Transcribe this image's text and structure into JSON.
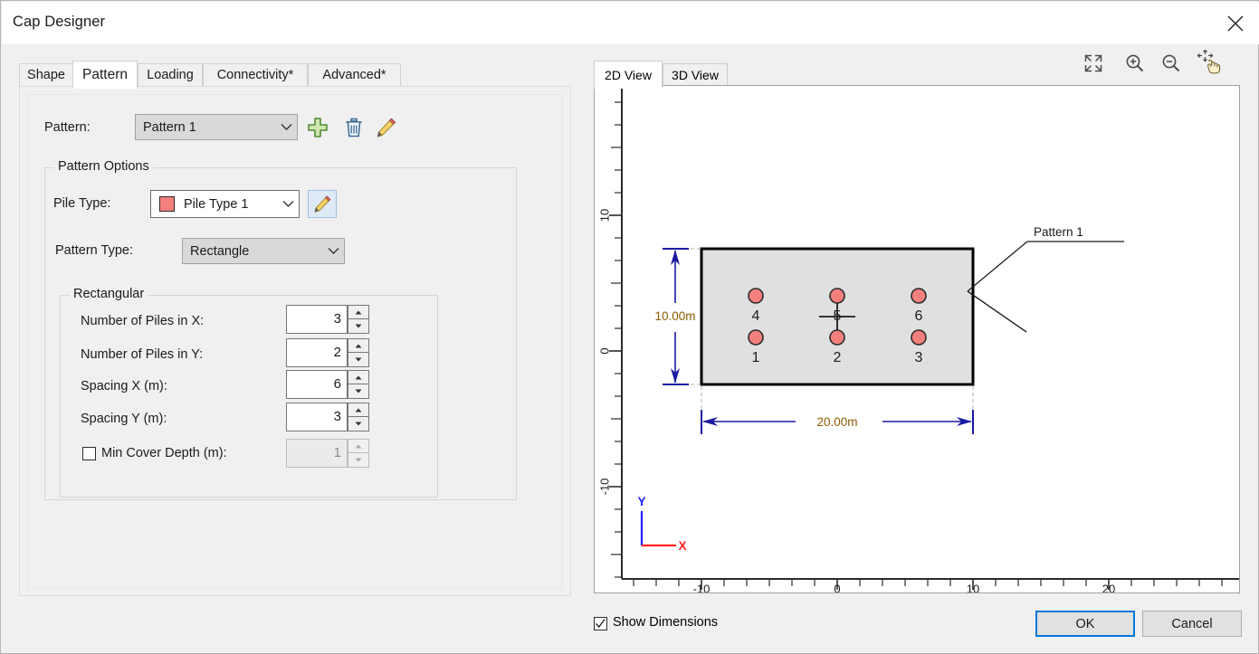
{
  "window": {
    "title": "Cap Designer",
    "close_icon": "close-icon"
  },
  "tabs": [
    {
      "label": "Shape",
      "active": false
    },
    {
      "label": "Pattern",
      "active": true
    },
    {
      "label": "Loading",
      "active": false
    },
    {
      "label": "Connectivity*",
      "active": false
    },
    {
      "label": "Advanced*",
      "active": false
    }
  ],
  "pattern_row": {
    "label": "Pattern:",
    "selected": "Pattern 1",
    "add_icon": "plus-icon",
    "delete_icon": "trash-icon",
    "edit_icon": "pencil-icon"
  },
  "pattern_options": {
    "title": "Pattern Options",
    "pile_type_label": "Pile Type:",
    "pile_type_value": "Pile Type 1",
    "pile_type_color": "#f4807e",
    "pile_type_edit_icon": "pencil-icon",
    "pattern_type_label": "Pattern Type:",
    "pattern_type_value": "Rectangle"
  },
  "rectangular": {
    "title": "Rectangular",
    "fields": [
      {
        "label": "Number of Piles in X:",
        "value": "3",
        "enabled": true
      },
      {
        "label": "Number of Piles in Y:",
        "value": "2",
        "enabled": true
      },
      {
        "label": "Spacing X (m):",
        "value": "6",
        "enabled": true
      },
      {
        "label": "Spacing Y (m):",
        "value": "3",
        "enabled": true
      }
    ],
    "min_cover": {
      "label": "Min Cover Depth (m):",
      "value": "1",
      "checked": false,
      "enabled": false
    }
  },
  "view": {
    "tabs": [
      {
        "label": "2D View",
        "active": true
      },
      {
        "label": "3D View",
        "active": false
      }
    ],
    "tools": [
      {
        "name": "fit-to-view-icon"
      },
      {
        "name": "zoom-in-icon"
      },
      {
        "name": "zoom-out-icon"
      },
      {
        "name": "pan-hand-icon"
      }
    ]
  },
  "footer": {
    "show_dimensions_label": "Show Dimensions",
    "show_dimensions_checked": true,
    "ok_label": "OK",
    "cancel_label": "Cancel"
  },
  "chart_data": {
    "type": "scatter",
    "title": "",
    "xlabel": "X",
    "ylabel": "Y",
    "xlim": [
      -16.5,
      26.5
    ],
    "ylim": [
      -15.5,
      15.5
    ],
    "x_ticks": [
      -10,
      0,
      10,
      20
    ],
    "x_tick_labels": [
      "-10",
      "0",
      "10",
      "20"
    ],
    "y_ticks": [
      10,
      0,
      -10
    ],
    "y_tick_labels": [
      "10",
      "0",
      "-10"
    ],
    "grid": false,
    "legend": "none",
    "cap_rectangle": {
      "x_min": -10,
      "x_max": 10,
      "y_min": -5,
      "y_max": 5,
      "fill": "#e0e0e0",
      "stroke": "#000000",
      "width_label": "20.00m",
      "height_label": "10.00m"
    },
    "dimension_color": "#1a1aa0",
    "pile_marker_color": "#f4807e",
    "pile_marker_edge": "#2b2b2b",
    "piles": [
      {
        "id": "1",
        "x": -6,
        "y": -1.5
      },
      {
        "id": "2",
        "x": 0,
        "y": -1.5
      },
      {
        "id": "3",
        "x": 6,
        "y": -1.5
      },
      {
        "id": "4",
        "x": -6,
        "y": 1.5
      },
      {
        "id": "5",
        "x": 0,
        "y": 1.5
      },
      {
        "id": "6",
        "x": 6,
        "y": 1.5
      }
    ],
    "annotations": [
      {
        "text": "Pattern 1",
        "target_pile": "6"
      }
    ],
    "origin_marker": {
      "x": 0,
      "y": 0,
      "type": "crosshair"
    },
    "axis_indicator": {
      "x_label": "X",
      "x_color": "#ff2020",
      "y_label": "Y",
      "y_color": "#2020ff"
    }
  }
}
